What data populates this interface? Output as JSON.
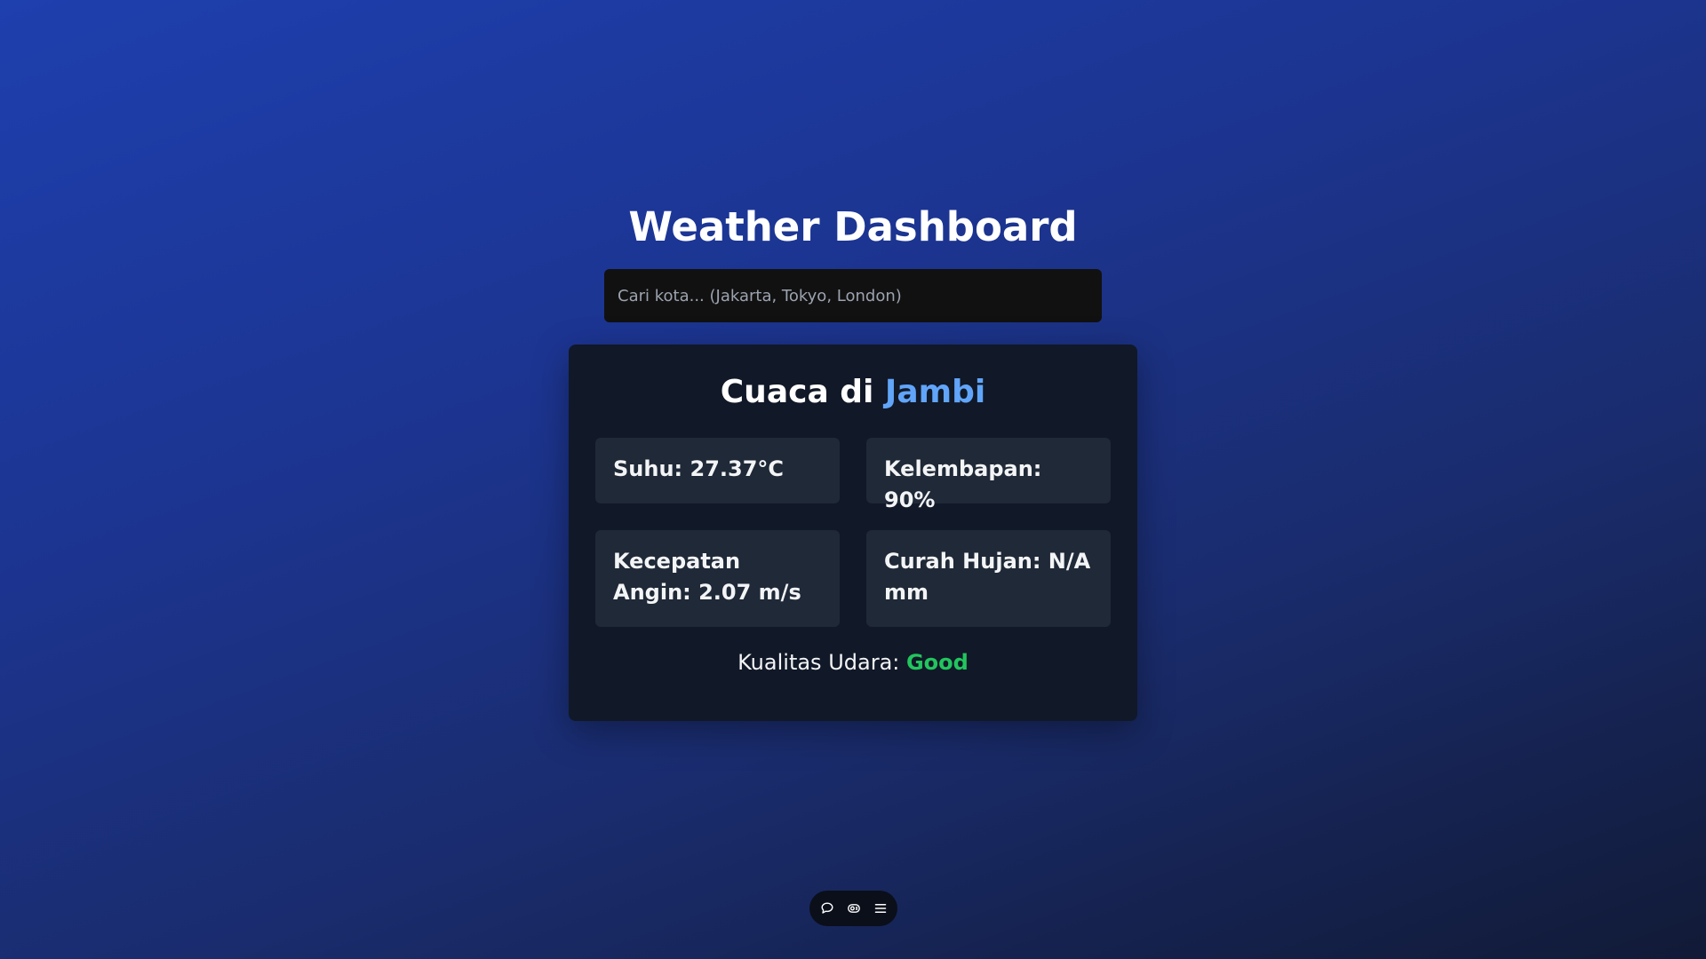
{
  "header": {
    "title": "Weather Dashboard"
  },
  "search": {
    "placeholder": "Cari kota... (Jakarta, Tokyo, London)",
    "value": ""
  },
  "weather": {
    "heading_prefix": "Cuaca di ",
    "city": "Jambi",
    "stats": {
      "temperature": "Suhu: 27.37°C",
      "humidity": "Kelembapan: 90%",
      "wind_speed": "Kecepatan Angin: 2.07 m/s",
      "rainfall": "Curah Hujan: N/A mm"
    },
    "air_quality_label": "Kualitas Udara: ",
    "air_quality_value": "Good"
  },
  "toolbar": {
    "icons": [
      "chat-icon",
      "eye-icon",
      "menu-icon"
    ]
  },
  "colors": {
    "accent_city": "#60a5fa",
    "air_quality_good": "#22c55e",
    "card_bg": "#111827",
    "stat_bg": "#1f2937"
  }
}
